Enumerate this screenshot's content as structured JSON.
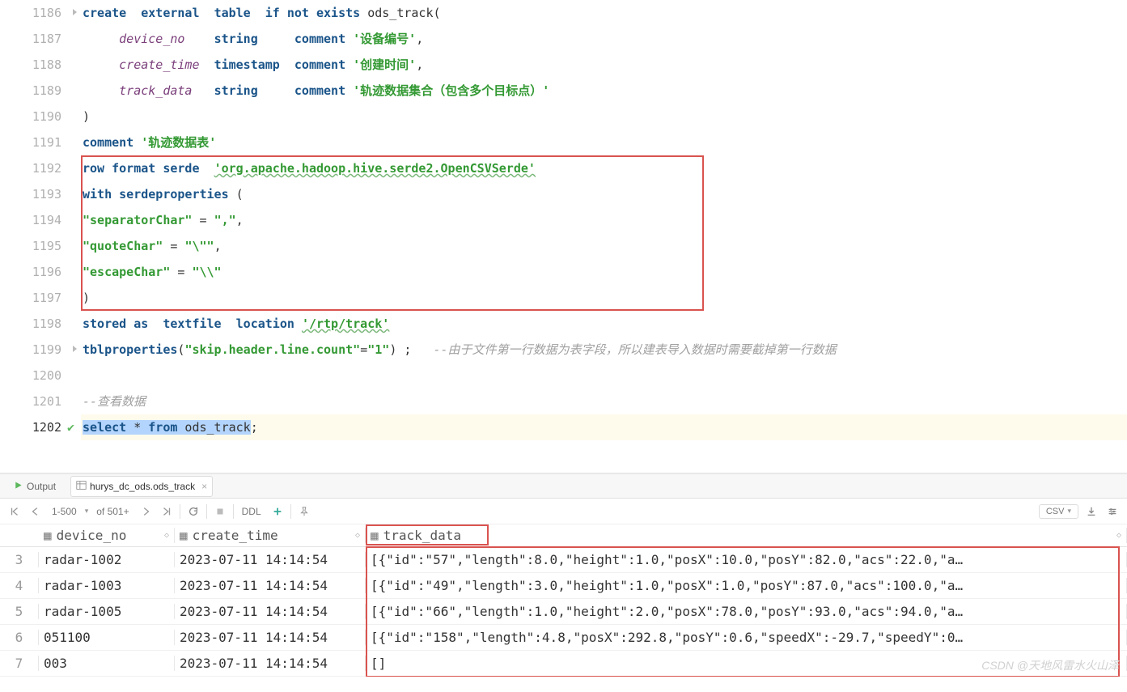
{
  "editor": {
    "lines": [
      {
        "no": "1186"
      },
      {
        "no": "1187"
      },
      {
        "no": "1188"
      },
      {
        "no": "1189"
      },
      {
        "no": "1190"
      },
      {
        "no": "1191"
      },
      {
        "no": "1192"
      },
      {
        "no": "1193"
      },
      {
        "no": "1194"
      },
      {
        "no": "1195"
      },
      {
        "no": "1196"
      },
      {
        "no": "1197"
      },
      {
        "no": "1198"
      },
      {
        "no": "1199"
      },
      {
        "no": "1200"
      },
      {
        "no": "1201"
      },
      {
        "no": "1202"
      }
    ],
    "l1186": {
      "kw1": "create",
      "kw2": "external",
      "kw3": "table",
      "kw4": "if not exists",
      "id": "ods_track",
      "paren": "("
    },
    "l1187": {
      "col": "device_no",
      "type": "string",
      "kw": "comment",
      "str": "'设备编号'",
      "comma": ","
    },
    "l1188": {
      "col": "create_time",
      "type": "timestamp",
      "kw": "comment",
      "str": "'创建时间'",
      "comma": ","
    },
    "l1189": {
      "col": "track_data",
      "type": "string",
      "kw": "comment",
      "str": "'轨迹数据集合（包含多个目标点）'"
    },
    "l1190": {
      "paren": ")"
    },
    "l1191": {
      "kw": "comment",
      "str": "'轨迹数据表'"
    },
    "l1192": {
      "kw": "row format serde",
      "str": "'org.apache.hadoop.hive.serde2.OpenCSVSerde'"
    },
    "l1193": {
      "kw": "with serdeproperties",
      "paren": "("
    },
    "l1194": {
      "str1": "\"separatorChar\"",
      "op": "=",
      "str2": "\",\"",
      "comma": ","
    },
    "l1195": {
      "str1": "\"quoteChar\"",
      "op": "=",
      "str2": "\"\\\"\"",
      "comma": ","
    },
    "l1196": {
      "str1": "\"escapeChar\"",
      "op": "=",
      "str2": "\"\\\\\""
    },
    "l1197": {
      "paren": ")"
    },
    "l1198": {
      "kw1": "stored as",
      "kw2": "textfile",
      "kw3": "location",
      "str": "'/rtp/track'"
    },
    "l1199": {
      "kw": "tblproperties",
      "paren1": "(",
      "str1": "\"skip.header.line.count\"",
      "op": "=",
      "str2": "\"1\"",
      "paren2": ")",
      "semi": " ;",
      "cmt": "--由于文件第一行数据为表字段，所以建表导入数据时需要截掉第一行数据"
    },
    "l1201": {
      "cmt": "--查看数据"
    },
    "l1202": {
      "kw1": "select",
      "star": " * ",
      "kw2": "from",
      "id": " ods_track",
      "semi": ";"
    }
  },
  "tabs": {
    "t1": "Output",
    "t2": "hurys_dc_ods.ods_track"
  },
  "toolbar": {
    "page_range": "1-500",
    "page_of": "of 501+",
    "ddl": "DDL",
    "csv": "CSV"
  },
  "results": {
    "columns": {
      "c1": "device_no",
      "c2": "create_time",
      "c3": "track_data"
    },
    "rows": [
      {
        "n": "3",
        "c1": "radar-1002",
        "c2": "2023-07-11 14:14:54",
        "c3": "[{\"id\":\"57\",\"length\":8.0,\"height\":1.0,\"posX\":10.0,\"posY\":82.0,\"acs\":22.0,\"a…"
      },
      {
        "n": "4",
        "c1": "radar-1003",
        "c2": "2023-07-11 14:14:54",
        "c3": "[{\"id\":\"49\",\"length\":3.0,\"height\":1.0,\"posX\":1.0,\"posY\":87.0,\"acs\":100.0,\"a…"
      },
      {
        "n": "5",
        "c1": "radar-1005",
        "c2": "2023-07-11 14:14:54",
        "c3": "[{\"id\":\"66\",\"length\":1.0,\"height\":2.0,\"posX\":78.0,\"posY\":93.0,\"acs\":94.0,\"a…"
      },
      {
        "n": "6",
        "c1": "051100",
        "c2": "2023-07-11 14:14:54",
        "c3": "[{\"id\":\"158\",\"length\":4.8,\"posX\":292.8,\"posY\":0.6,\"speedX\":-29.7,\"speedY\":0…"
      },
      {
        "n": "7",
        "c1": "003",
        "c2": "2023-07-11 14:14:54",
        "c3": "[]"
      }
    ]
  },
  "watermark": "CSDN @天地风雷水火山泽"
}
